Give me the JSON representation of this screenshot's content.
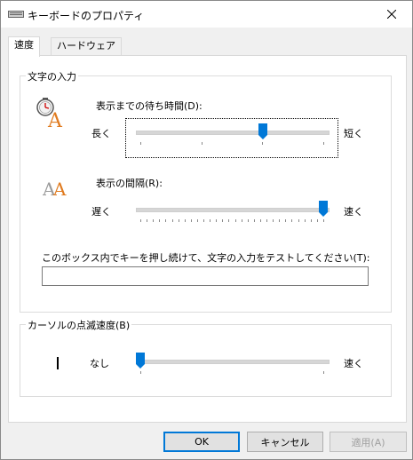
{
  "window": {
    "title": "キーボードのプロパティ"
  },
  "tabs": [
    {
      "label": "速度"
    },
    {
      "label": "ハードウェア"
    }
  ],
  "char_input": {
    "group_label": "文字の入力",
    "delay": {
      "label": "表示までの待ち時間(D):",
      "left": "長く",
      "right": "短く",
      "value_fraction": 0.67
    },
    "rate": {
      "label": "表示の間隔(R):",
      "left": "遅く",
      "right": "速く",
      "value_fraction": 1.0
    },
    "test": {
      "label": "このボックス内でキーを押し続けて、文字の入力をテストしてください(T):",
      "value": ""
    }
  },
  "cursor": {
    "group_label": "カーソルの点滅速度(B)",
    "left": "なし",
    "right": "速く",
    "value_fraction": 0.0
  },
  "buttons": {
    "ok": "OK",
    "cancel": "キャンセル",
    "apply": "適用(A)"
  },
  "colors": {
    "accent": "#0078d7"
  }
}
